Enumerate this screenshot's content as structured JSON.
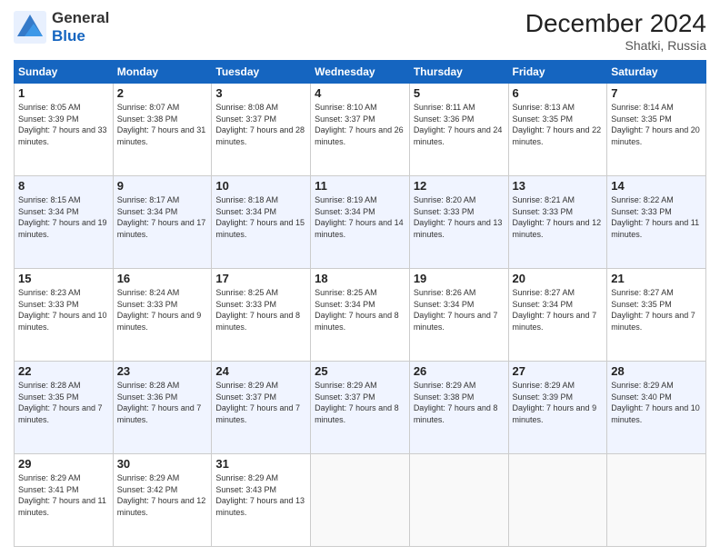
{
  "header": {
    "logo_general": "General",
    "logo_blue": "Blue",
    "month": "December 2024",
    "location": "Shatki, Russia"
  },
  "weekdays": [
    "Sunday",
    "Monday",
    "Tuesday",
    "Wednesday",
    "Thursday",
    "Friday",
    "Saturday"
  ],
  "weeks": [
    [
      {
        "day": "1",
        "sunrise": "Sunrise: 8:05 AM",
        "sunset": "Sunset: 3:39 PM",
        "daylight": "Daylight: 7 hours and 33 minutes."
      },
      {
        "day": "2",
        "sunrise": "Sunrise: 8:07 AM",
        "sunset": "Sunset: 3:38 PM",
        "daylight": "Daylight: 7 hours and 31 minutes."
      },
      {
        "day": "3",
        "sunrise": "Sunrise: 8:08 AM",
        "sunset": "Sunset: 3:37 PM",
        "daylight": "Daylight: 7 hours and 28 minutes."
      },
      {
        "day": "4",
        "sunrise": "Sunrise: 8:10 AM",
        "sunset": "Sunset: 3:37 PM",
        "daylight": "Daylight: 7 hours and 26 minutes."
      },
      {
        "day": "5",
        "sunrise": "Sunrise: 8:11 AM",
        "sunset": "Sunset: 3:36 PM",
        "daylight": "Daylight: 7 hours and 24 minutes."
      },
      {
        "day": "6",
        "sunrise": "Sunrise: 8:13 AM",
        "sunset": "Sunset: 3:35 PM",
        "daylight": "Daylight: 7 hours and 22 minutes."
      },
      {
        "day": "7",
        "sunrise": "Sunrise: 8:14 AM",
        "sunset": "Sunset: 3:35 PM",
        "daylight": "Daylight: 7 hours and 20 minutes."
      }
    ],
    [
      {
        "day": "8",
        "sunrise": "Sunrise: 8:15 AM",
        "sunset": "Sunset: 3:34 PM",
        "daylight": "Daylight: 7 hours and 19 minutes."
      },
      {
        "day": "9",
        "sunrise": "Sunrise: 8:17 AM",
        "sunset": "Sunset: 3:34 PM",
        "daylight": "Daylight: 7 hours and 17 minutes."
      },
      {
        "day": "10",
        "sunrise": "Sunrise: 8:18 AM",
        "sunset": "Sunset: 3:34 PM",
        "daylight": "Daylight: 7 hours and 15 minutes."
      },
      {
        "day": "11",
        "sunrise": "Sunrise: 8:19 AM",
        "sunset": "Sunset: 3:34 PM",
        "daylight": "Daylight: 7 hours and 14 minutes."
      },
      {
        "day": "12",
        "sunrise": "Sunrise: 8:20 AM",
        "sunset": "Sunset: 3:33 PM",
        "daylight": "Daylight: 7 hours and 13 minutes."
      },
      {
        "day": "13",
        "sunrise": "Sunrise: 8:21 AM",
        "sunset": "Sunset: 3:33 PM",
        "daylight": "Daylight: 7 hours and 12 minutes."
      },
      {
        "day": "14",
        "sunrise": "Sunrise: 8:22 AM",
        "sunset": "Sunset: 3:33 PM",
        "daylight": "Daylight: 7 hours and 11 minutes."
      }
    ],
    [
      {
        "day": "15",
        "sunrise": "Sunrise: 8:23 AM",
        "sunset": "Sunset: 3:33 PM",
        "daylight": "Daylight: 7 hours and 10 minutes."
      },
      {
        "day": "16",
        "sunrise": "Sunrise: 8:24 AM",
        "sunset": "Sunset: 3:33 PM",
        "daylight": "Daylight: 7 hours and 9 minutes."
      },
      {
        "day": "17",
        "sunrise": "Sunrise: 8:25 AM",
        "sunset": "Sunset: 3:33 PM",
        "daylight": "Daylight: 7 hours and 8 minutes."
      },
      {
        "day": "18",
        "sunrise": "Sunrise: 8:25 AM",
        "sunset": "Sunset: 3:34 PM",
        "daylight": "Daylight: 7 hours and 8 minutes."
      },
      {
        "day": "19",
        "sunrise": "Sunrise: 8:26 AM",
        "sunset": "Sunset: 3:34 PM",
        "daylight": "Daylight: 7 hours and 7 minutes."
      },
      {
        "day": "20",
        "sunrise": "Sunrise: 8:27 AM",
        "sunset": "Sunset: 3:34 PM",
        "daylight": "Daylight: 7 hours and 7 minutes."
      },
      {
        "day": "21",
        "sunrise": "Sunrise: 8:27 AM",
        "sunset": "Sunset: 3:35 PM",
        "daylight": "Daylight: 7 hours and 7 minutes."
      }
    ],
    [
      {
        "day": "22",
        "sunrise": "Sunrise: 8:28 AM",
        "sunset": "Sunset: 3:35 PM",
        "daylight": "Daylight: 7 hours and 7 minutes."
      },
      {
        "day": "23",
        "sunrise": "Sunrise: 8:28 AM",
        "sunset": "Sunset: 3:36 PM",
        "daylight": "Daylight: 7 hours and 7 minutes."
      },
      {
        "day": "24",
        "sunrise": "Sunrise: 8:29 AM",
        "sunset": "Sunset: 3:37 PM",
        "daylight": "Daylight: 7 hours and 7 minutes."
      },
      {
        "day": "25",
        "sunrise": "Sunrise: 8:29 AM",
        "sunset": "Sunset: 3:37 PM",
        "daylight": "Daylight: 7 hours and 8 minutes."
      },
      {
        "day": "26",
        "sunrise": "Sunrise: 8:29 AM",
        "sunset": "Sunset: 3:38 PM",
        "daylight": "Daylight: 7 hours and 8 minutes."
      },
      {
        "day": "27",
        "sunrise": "Sunrise: 8:29 AM",
        "sunset": "Sunset: 3:39 PM",
        "daylight": "Daylight: 7 hours and 9 minutes."
      },
      {
        "day": "28",
        "sunrise": "Sunrise: 8:29 AM",
        "sunset": "Sunset: 3:40 PM",
        "daylight": "Daylight: 7 hours and 10 minutes."
      }
    ],
    [
      {
        "day": "29",
        "sunrise": "Sunrise: 8:29 AM",
        "sunset": "Sunset: 3:41 PM",
        "daylight": "Daylight: 7 hours and 11 minutes."
      },
      {
        "day": "30",
        "sunrise": "Sunrise: 8:29 AM",
        "sunset": "Sunset: 3:42 PM",
        "daylight": "Daylight: 7 hours and 12 minutes."
      },
      {
        "day": "31",
        "sunrise": "Sunrise: 8:29 AM",
        "sunset": "Sunset: 3:43 PM",
        "daylight": "Daylight: 7 hours and 13 minutes."
      },
      null,
      null,
      null,
      null
    ]
  ]
}
